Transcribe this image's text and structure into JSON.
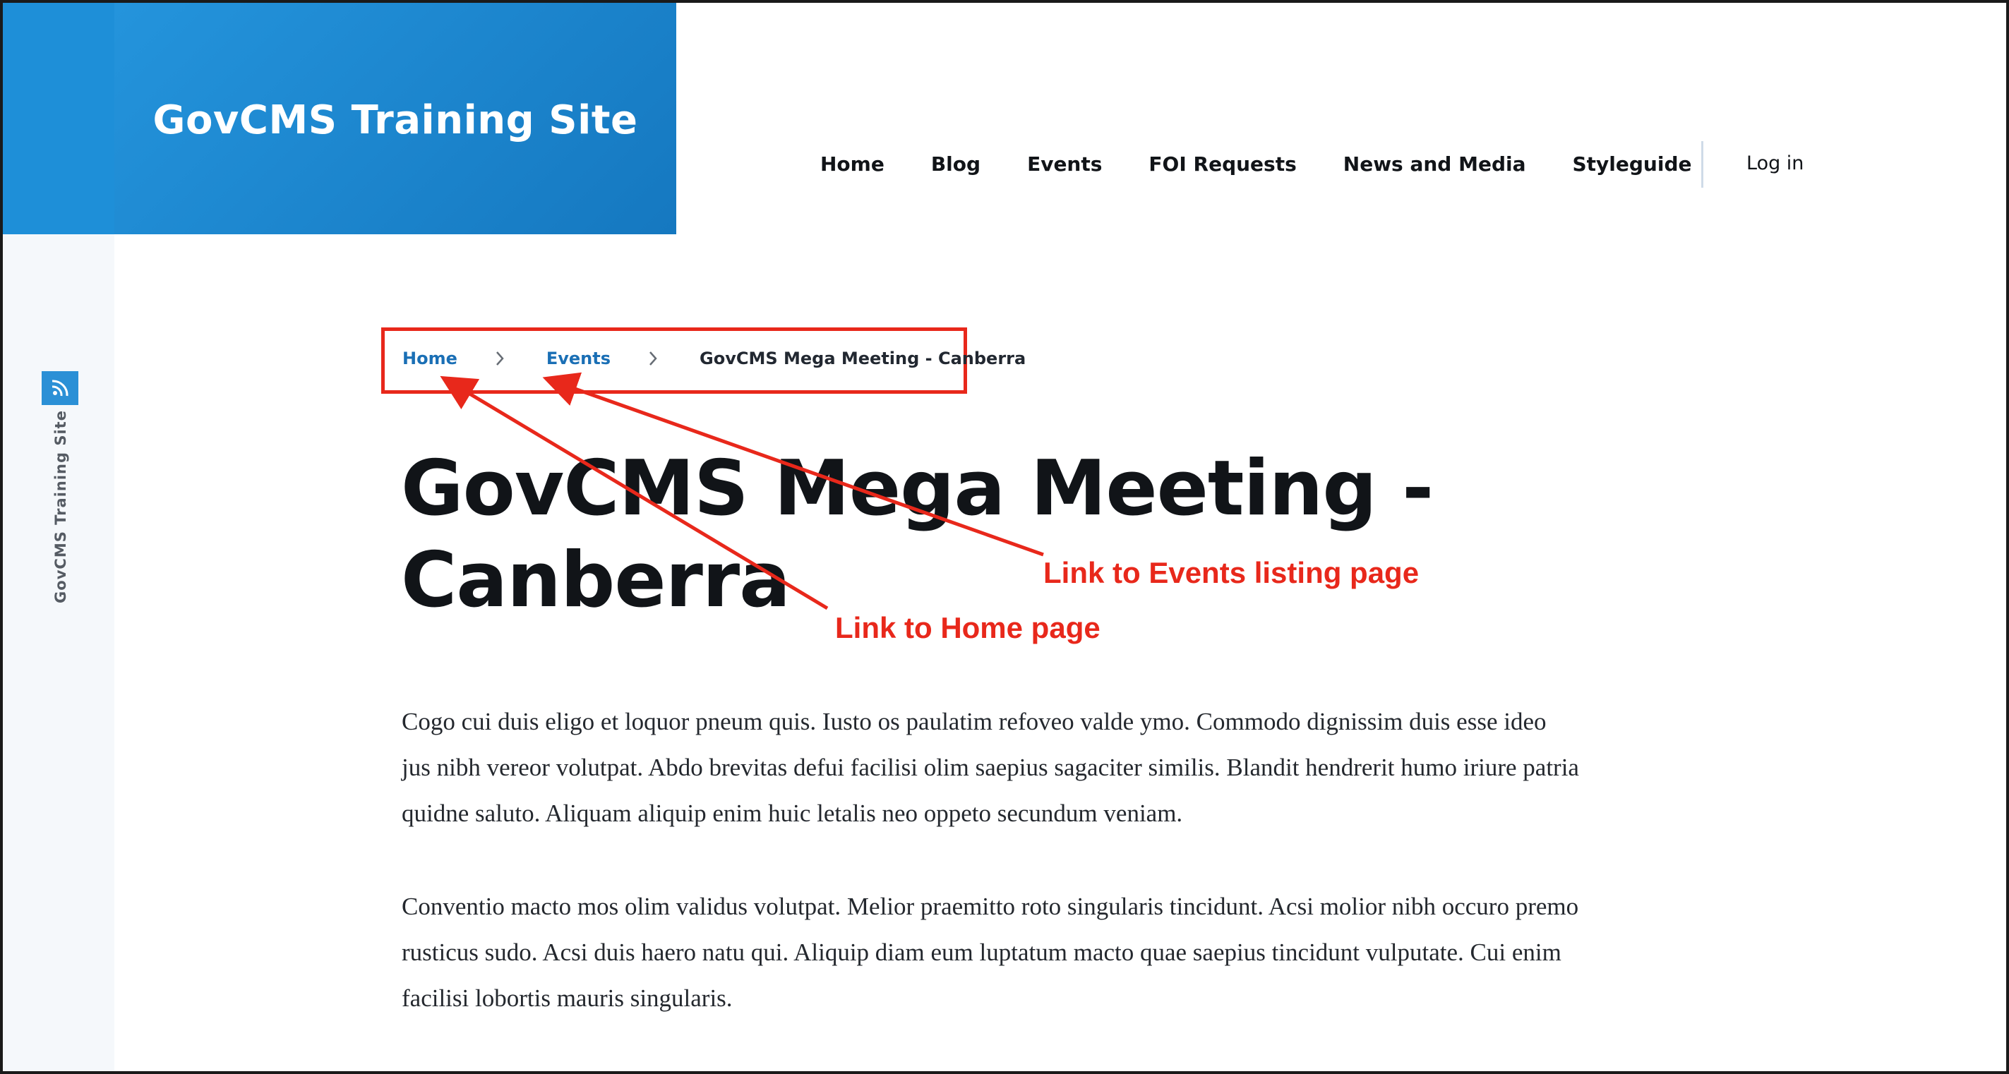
{
  "site": {
    "name": "GovCMS Training Site",
    "sidebar_label": "GovCMS Training Site",
    "sidebar_icon": "rss-feed-icon"
  },
  "nav": {
    "items": [
      "Home",
      "Blog",
      "Events",
      "FOI Requests",
      "News and Media",
      "Styleguide"
    ],
    "login": "Log in"
  },
  "breadcrumb": {
    "items": [
      {
        "label": "Home",
        "link": true
      },
      {
        "label": "Events",
        "link": true
      },
      {
        "label": "GovCMS Mega Meeting - Canberra",
        "link": false
      }
    ],
    "separator_icon": "chevron-right-icon"
  },
  "page": {
    "title_line1": "GovCMS Mega Meeting -",
    "title_line2": "Canberra",
    "paragraphs": [
      "Cogo cui duis eligo et loquor pneum quis. Iusto os paulatim refoveo valde ymo. Commodo dignissim duis esse ideo jus nibh vereor volutpat. Abdo brevitas defui facilisi olim saepius sagaciter similis. Blandit hendrerit humo iriure patria quidne saluto. Aliquam aliquip enim huic letalis neo oppeto secundum veniam.",
      "Conventio macto mos olim validus volutpat. Melior praemitto roto singularis tincidunt. Acsi molior nibh occuro premo rusticus sudo. Acsi duis haero natu qui. Aliquip diam eum luptatum macto quae saepius tincidunt vulputate. Cui enim facilisi lobortis mauris singularis."
    ]
  },
  "annotations": {
    "events_label": "Link to Events listing page",
    "home_label": "Link to Home page"
  },
  "colors": {
    "brand_blue": "#1e8fd8",
    "link_blue": "#1a6fb5",
    "annotation_red": "#e8281b",
    "sidebar_bg": "#f5f8fb"
  }
}
